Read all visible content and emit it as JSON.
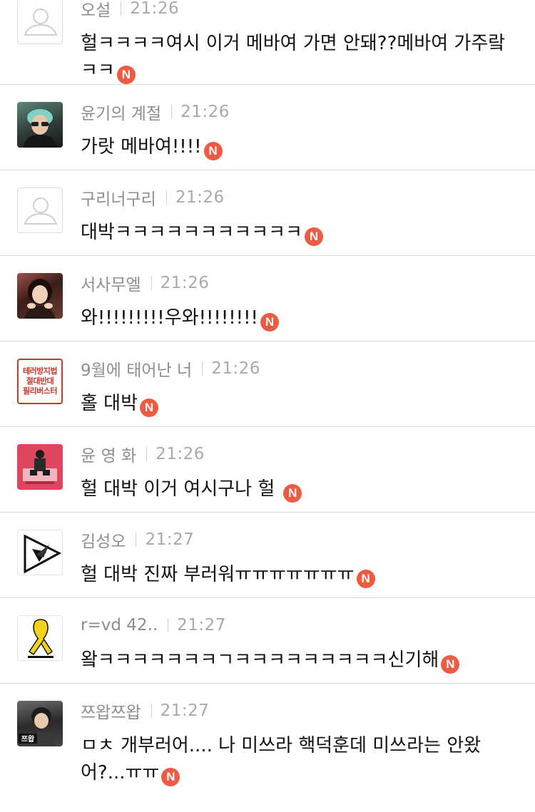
{
  "comments": [
    {
      "author": "오설",
      "time": "21:26",
      "text": "헐ㅋㅋㅋㅋ여시 이거 메바여 가면 안돼??메바여 가주랔ㅋㅋ",
      "avatar": "default-avatar-icon"
    },
    {
      "author": "윤기의 계절",
      "time": "21:26",
      "text": "가랏 메바여!!!!",
      "avatar": "photo"
    },
    {
      "author": "구리너구리",
      "time": "21:26",
      "text": "대박ㅋㅋㅋㅋㅋㅋㅋㅋㅋㅋㅋ",
      "avatar": "default-avatar-icon"
    },
    {
      "author": "서사무엘",
      "time": "21:26",
      "text": "와!!!!!!!!!우와!!!!!!!!",
      "avatar": "photo"
    },
    {
      "author": "9월에 태어난 너",
      "time": "21:26",
      "text": "홀 대박",
      "avatar": "text-avatar",
      "avatar_text": [
        "테러방지법",
        "절대반대",
        "필리버스터"
      ]
    },
    {
      "author": "윤 영 화",
      "time": "21:26",
      "text": "헐 대박 이거 여시구나 헐",
      "avatar": "illustration"
    },
    {
      "author": "김성오",
      "time": "21:27",
      "text": "헐 대박 진짜 부러워ㅠㅠㅠㅠㅠㅠㅠ",
      "avatar": "triangle-logo"
    },
    {
      "author": "r=vd 42..",
      "time": "21:27",
      "text": "왘ㅋㅋㅋㅋㅋㅋㅋㄱㅋㅋㅋㅋㅋㅋㅋㅋㅋ신기해",
      "avatar": "yellow-ribbon"
    },
    {
      "author": "쯔왑쯔왑",
      "time": "21:27",
      "text": "ㅁㅊ 개부러어.... 나 미쓰라 핵덕훈데 미쓰라는 안왔어?...ㅠㅠ",
      "avatar": "photo",
      "avatar_text": "쯔왑"
    }
  ],
  "new_badge": "N",
  "colors": {
    "badge": "#ef5a43",
    "author": "#8e8e8e",
    "time": "#a9a9a9",
    "divider": "#d9d9d9",
    "text": "#111111"
  }
}
